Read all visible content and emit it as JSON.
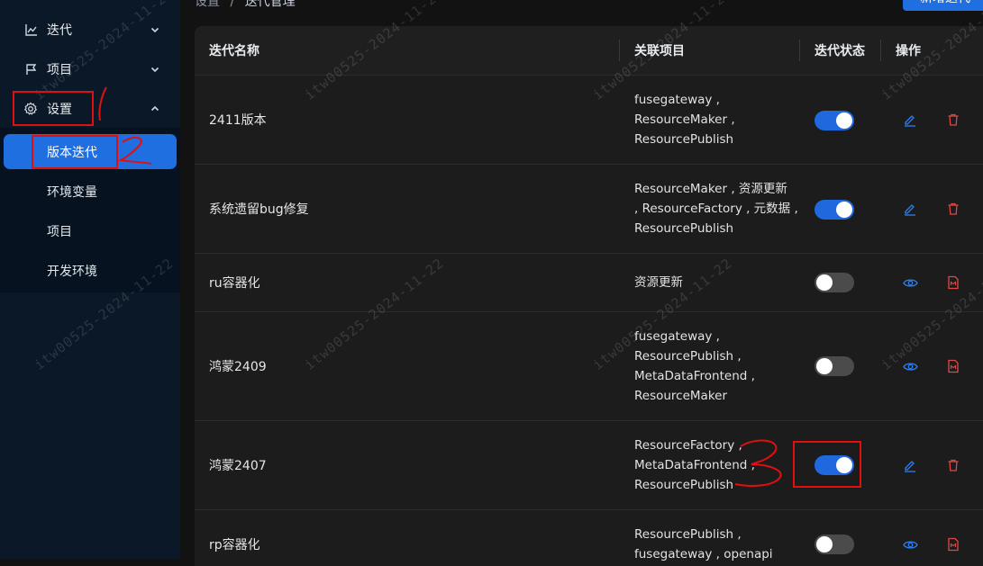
{
  "sidebar": {
    "menu": [
      {
        "label": "迭代",
        "icon": "chart-line-icon",
        "chevron": "chevron-down-icon"
      },
      {
        "label": "项目",
        "icon": "flag-icon",
        "chevron": "chevron-down-icon"
      },
      {
        "label": "设置",
        "icon": "gear-icon",
        "chevron": "chevron-up-icon"
      }
    ],
    "submenu": [
      {
        "label": "版本迭代",
        "active": true
      },
      {
        "label": "环境变量",
        "active": false
      },
      {
        "label": "项目",
        "active": false
      },
      {
        "label": "开发环境",
        "active": false
      }
    ]
  },
  "header": {
    "breadcrumb": {
      "parent": "设置",
      "separator": "/",
      "current": "迭代管理"
    },
    "new_button": "新增迭代"
  },
  "table": {
    "columns": {
      "name": "迭代名称",
      "projects": "关联项目",
      "status": "迭代状态",
      "actions": "操作"
    },
    "rows": [
      {
        "name": "2411版本",
        "projects": [
          "fusegateway ,",
          "ResourceMaker ,",
          "ResourcePublish"
        ],
        "status": true,
        "actions": [
          "edit-icon",
          "delete-icon"
        ]
      },
      {
        "name": "系统遗留bug修复",
        "projects": [
          "ResourceMaker , 资源更新",
          ", ResourceFactory , 元数据 ,",
          "ResourcePublish"
        ],
        "status": true,
        "actions": [
          "edit-icon",
          "delete-icon"
        ]
      },
      {
        "name": "ru容器化",
        "projects": [
          "资源更新"
        ],
        "status": false,
        "actions": [
          "view-icon",
          "document-icon"
        ]
      },
      {
        "name": "鸿蒙2409",
        "projects": [
          "fusegateway ,",
          "ResourcePublish ,",
          "MetaDataFrontend ,",
          "ResourceMaker"
        ],
        "status": false,
        "actions": [
          "view-icon",
          "document-icon"
        ]
      },
      {
        "name": "鸿蒙2407",
        "projects": [
          "ResourceFactory ,",
          "MetaDataFrontend ,",
          "ResourcePublish"
        ],
        "status": true,
        "actions": [
          "edit-icon",
          "delete-icon"
        ]
      },
      {
        "name": "rp容器化",
        "projects": [
          "ResourcePublish ,",
          "fusegateway , openapi"
        ],
        "status": false,
        "actions": [
          "view-icon",
          "document-icon"
        ]
      }
    ]
  },
  "annotations": {
    "mark1": "1",
    "mark2": "2",
    "mark3": "3",
    "color": "#e01010"
  },
  "watermark": "itw00525-2024-11-22",
  "colors": {
    "accent": "#1f6fe0",
    "sidebar_bg": "#0b1828",
    "danger": "#e04848"
  }
}
